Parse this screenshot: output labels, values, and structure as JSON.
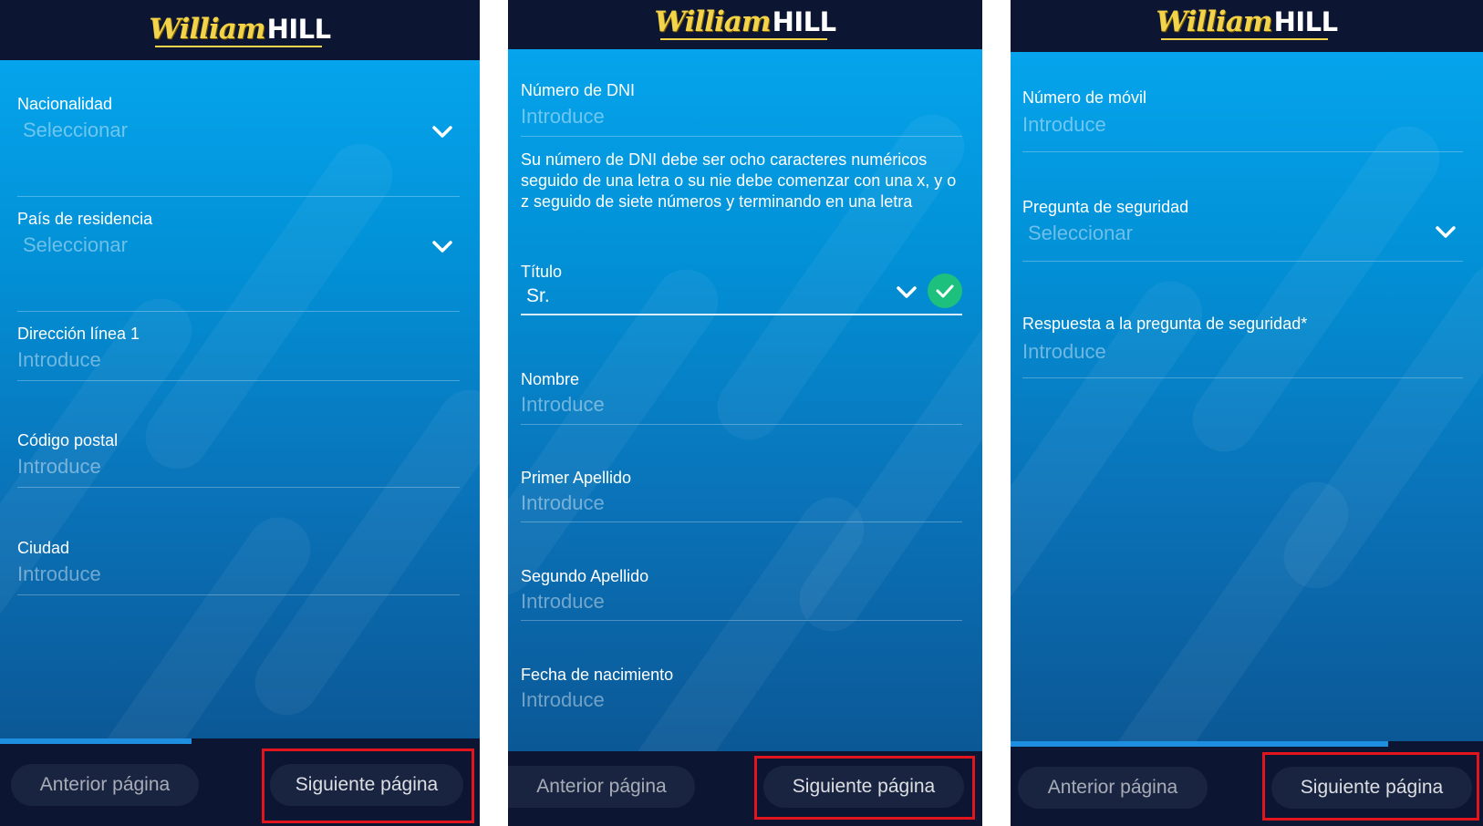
{
  "brand": {
    "script": "William",
    "block": "HILL"
  },
  "colors": {
    "header_bg": "#0c1633",
    "form_blue": "#0290d6",
    "check_green": "#1ec07d",
    "highlight_red": "#e2141c",
    "progress_blue": "#1e8fe0"
  },
  "screens": [
    {
      "fields": [
        {
          "label": "Nacionalidad",
          "value": "Seleccionar",
          "dropdown": true
        },
        {
          "label": "País de residencia",
          "value": "Seleccionar",
          "dropdown": true
        },
        {
          "label": "Dirección línea 1",
          "value": "Introduce"
        },
        {
          "label": "Código postal",
          "value": "Introduce"
        },
        {
          "label": "Ciudad",
          "value": "Introduce"
        }
      ],
      "progress_fraction": 0.4,
      "prev_label": "Anterior página",
      "next_label": "Siguiente página"
    },
    {
      "dni": {
        "label": "Número de DNI",
        "value": "Introduce"
      },
      "help_text": "Su número de DNI debe ser ocho caracteres numéricos seguido de una letra o su nie debe comenzar con una x, y o z seguido de siete números y terminando en una letra",
      "titulo": {
        "label": "Título",
        "value": "Sr.",
        "valid": true
      },
      "fields": [
        {
          "label": "Nombre",
          "value": "Introduce"
        },
        {
          "label": "Primer Apellido",
          "value": "Introduce"
        },
        {
          "label": "Segundo Apellido",
          "value": "Introduce"
        },
        {
          "label": "Fecha de nacimiento",
          "value": "Introduce"
        }
      ],
      "prev_label": "Anterior página",
      "next_label": "Siguiente página"
    },
    {
      "fields": [
        {
          "label": "Número de móvil",
          "value": "Introduce"
        },
        {
          "label": "Pregunta de seguridad",
          "value": "Seleccionar",
          "dropdown": true
        },
        {
          "label": "Respuesta a la pregunta de seguridad*",
          "value": "Introduce"
        }
      ],
      "progress_fraction": 0.8,
      "prev_label": "Anterior página",
      "next_label": "Siguiente página"
    }
  ]
}
